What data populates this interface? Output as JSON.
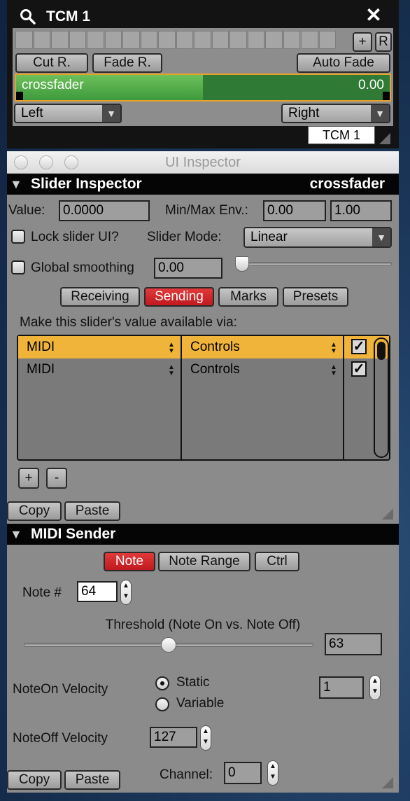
{
  "tcm": {
    "title": "TCM 1",
    "plus_label": "+",
    "r_label": "R",
    "cut_label": "Cut R.",
    "fade_label": "Fade R.",
    "auto_fade_label": "Auto Fade",
    "slider": {
      "label": "crossfader",
      "value": "0.00",
      "fill_fraction": 0.5
    },
    "left_select": "Left",
    "right_select": "Right",
    "tab_label": "TCM 1",
    "icons": {
      "search": "search-icon",
      "close": "close-icon"
    }
  },
  "inspector": {
    "window_title": "UI Inspector",
    "slider_inspector": {
      "heading": "Slider Inspector",
      "target_name": "crossfader",
      "value_label": "Value:",
      "value": "0.0000",
      "minmax_label": "Min/Max Env.:",
      "min": "0.00",
      "max": "1.00",
      "lock_label": "Lock slider UI?",
      "mode_label": "Slider Mode:",
      "mode_value": "Linear",
      "smoothing_label": "Global smoothing",
      "smoothing_value": "0.00",
      "smoothing_fraction": 0.0,
      "tabs": [
        "Receiving",
        "Sending",
        "Marks",
        "Presets"
      ],
      "active_tab": "Sending",
      "available_via_label": "Make this slider's value available via:",
      "rows": [
        {
          "protocol": "MIDI",
          "type": "Controls",
          "enabled": true,
          "selected": true
        },
        {
          "protocol": "MIDI",
          "type": "Controls",
          "enabled": true,
          "selected": false
        }
      ],
      "add_label": "+",
      "remove_label": "-",
      "copy_label": "Copy",
      "paste_label": "Paste"
    },
    "midi_sender": {
      "heading": "MIDI Sender",
      "tabs": [
        "Note",
        "Note Range",
        "Ctrl"
      ],
      "active_tab": "Note",
      "note_label": "Note #",
      "note_value": "64",
      "threshold_label": "Threshold (Note On vs. Note Off)",
      "threshold_value": "63",
      "threshold_fraction": 0.5,
      "noteon_label": "NoteOn Velocity",
      "static_label": "Static",
      "variable_label": "Variable",
      "velocity_mode": "Static",
      "noteon_value": "1",
      "noteoff_label": "NoteOff Velocity",
      "noteoff_value": "127",
      "channel_label": "Channel:",
      "channel_value": "0",
      "copy_label": "Copy",
      "paste_label": "Paste"
    }
  },
  "colors": {
    "accent_orange": "#f0b43a",
    "active_red": "#c91f25",
    "slider_green": "#4caf50"
  }
}
